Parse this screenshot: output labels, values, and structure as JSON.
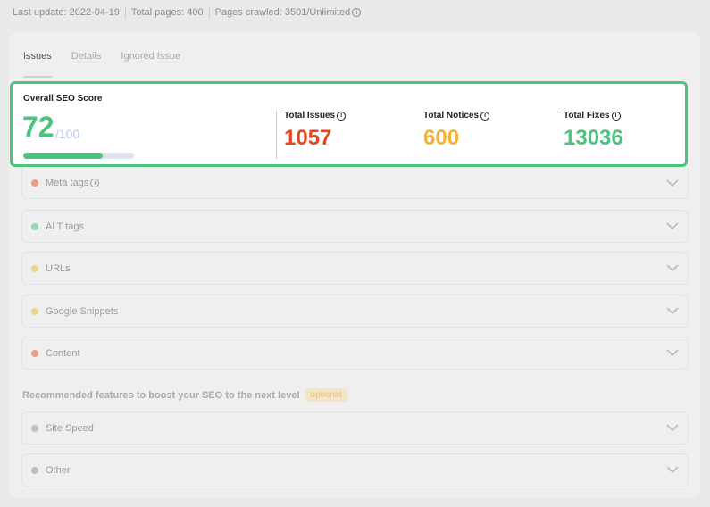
{
  "meta": {
    "last_update": "Last update: 2022-04-19",
    "total_pages": "Total pages: 400",
    "pages_crawled": "Pages crawled: 3501/Unlimited"
  },
  "tabs": [
    {
      "label": "Issues",
      "active": true
    },
    {
      "label": "Details",
      "active": false
    },
    {
      "label": "Ignored Issue",
      "active": false
    }
  ],
  "score": {
    "title": "Overall SEO Score",
    "value": "72",
    "max": "/100",
    "progress_fraction": 0.72,
    "color": "#4cc47f"
  },
  "stats": {
    "issues": {
      "label": "Total Issues",
      "value": "1057",
      "color": "#e8461e"
    },
    "notices": {
      "label": "Total Notices",
      "value": "600",
      "color": "#f5b330"
    },
    "fixes": {
      "label": "Total Fixes",
      "value": "13036",
      "color": "#4cc47f"
    }
  },
  "categories": [
    {
      "label": "Meta tags",
      "dot_color": "#f09a8a",
      "has_info": true
    },
    {
      "label": "ALT tags",
      "dot_color": "#92d8b1",
      "has_info": false
    },
    {
      "label": "URLs",
      "dot_color": "#f0d48a",
      "has_info": false
    },
    {
      "label": "Google Snippets",
      "dot_color": "#f0d48a",
      "has_info": false
    },
    {
      "label": "Content",
      "dot_color": "#f09a8a",
      "has_info": false
    }
  ],
  "recommended": {
    "title": "Recommended features to boost your SEO to the next level",
    "badge": "optional"
  },
  "recommended_items": [
    {
      "label": "Site Speed",
      "dot_color": "#b9c0cf"
    },
    {
      "label": "Other",
      "dot_color": "#b9c0cf"
    }
  ],
  "icons": {
    "info": "info-circle-icon",
    "chevron": "chevron-down-icon"
  }
}
